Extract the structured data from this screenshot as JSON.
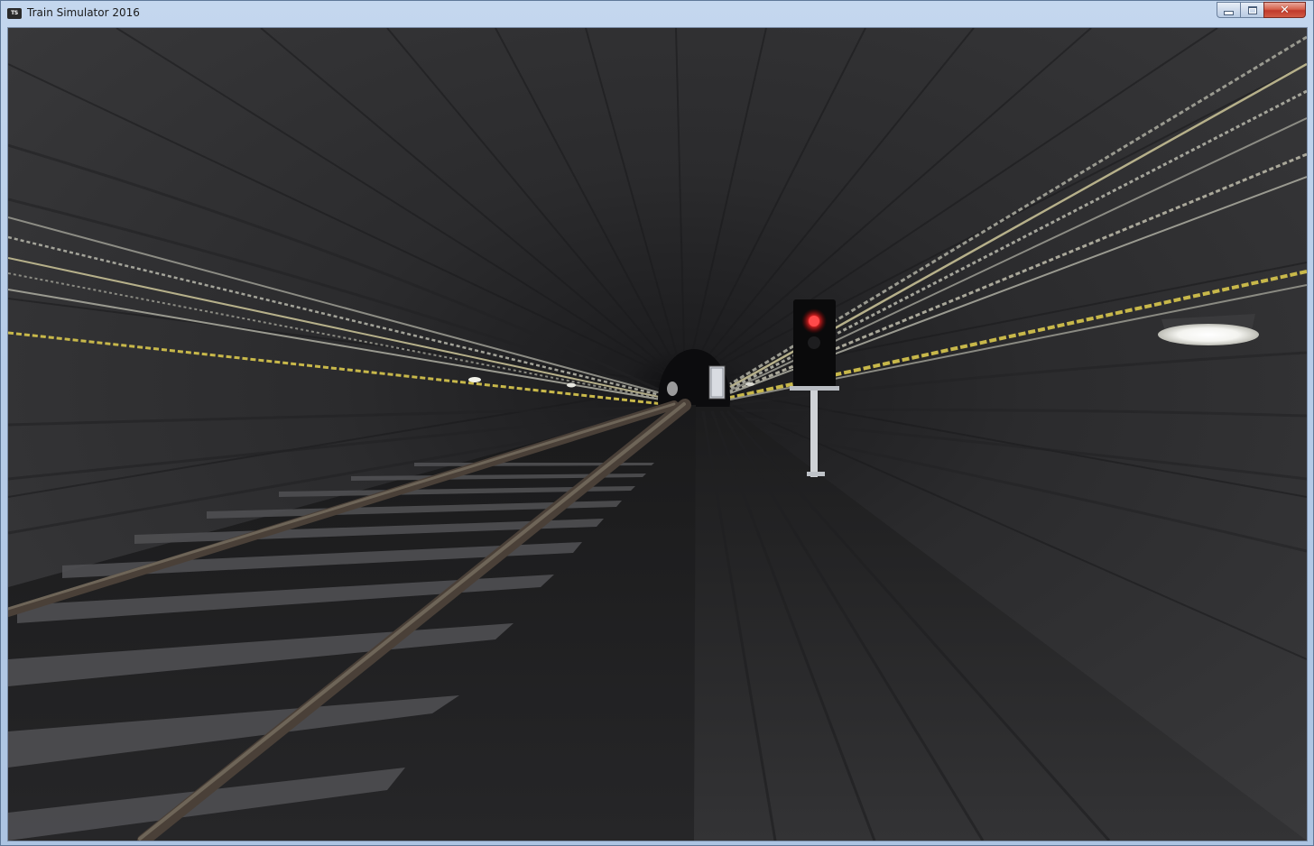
{
  "window": {
    "title": "Train Simulator 2016",
    "icon_label": "TS",
    "icon": "ts-app-icon",
    "controls": {
      "minimize_icon": "minimize-icon",
      "maximize_icon": "maximize-icon",
      "close_icon": "close-icon",
      "close_glyph": "✕"
    }
  },
  "scene": {
    "description_icon": "tunnel-scene",
    "signal_aspect": "red",
    "colors": {
      "tunnel_wall": "#2f2f31",
      "signal_red": "#ff2a2a",
      "cable_yellow": "#c8b84a",
      "rail_brown": "#4a4038"
    }
  }
}
